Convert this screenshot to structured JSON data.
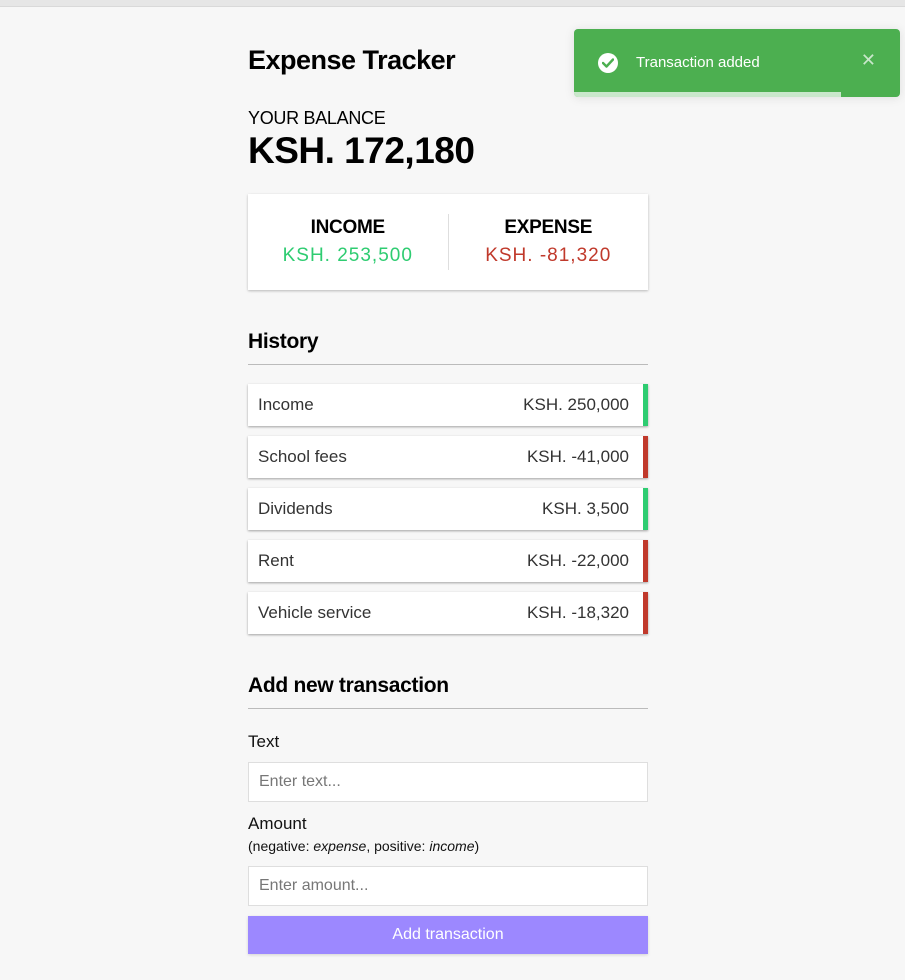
{
  "app": {
    "title": "Expense Tracker"
  },
  "balance": {
    "label": "YOUR BALANCE",
    "value": "KSH. 172,180"
  },
  "summary": {
    "income_label": "INCOME",
    "income_value": "KSH. 253,500",
    "expense_label": "EXPENSE",
    "expense_value": "KSH. -81,320",
    "income_color": "#2ecc71",
    "expense_color": "#c0392b"
  },
  "history": {
    "title": "History",
    "items": [
      {
        "text": "Income",
        "amount": "KSH. 250,000",
        "type": "plus"
      },
      {
        "text": "School fees",
        "amount": "KSH. -41,000",
        "type": "minus"
      },
      {
        "text": "Dividends",
        "amount": "KSH. 3,500",
        "type": "plus"
      },
      {
        "text": "Rent",
        "amount": "KSH. -22,000",
        "type": "minus"
      },
      {
        "text": "Vehicle service",
        "amount": "KSH. -18,320",
        "type": "minus"
      }
    ]
  },
  "form": {
    "title": "Add new transaction",
    "text_label": "Text",
    "text_placeholder": "Enter text...",
    "text_value": "",
    "amount_label": "Amount",
    "hint_prefix": "(negative: ",
    "hint_expense": "expense",
    "hint_middle": ", positive: ",
    "hint_income": "income",
    "hint_suffix": ")",
    "amount_placeholder": "Enter amount...",
    "amount_value": "",
    "submit_label": "Add transaction",
    "accent_color": "#9c88ff"
  },
  "toast": {
    "message": "Transaction added",
    "icon": "check-circle-icon",
    "close_icon": "close-icon",
    "close_glyph": "✕",
    "progress": 0.82,
    "color": "#4caf50"
  }
}
